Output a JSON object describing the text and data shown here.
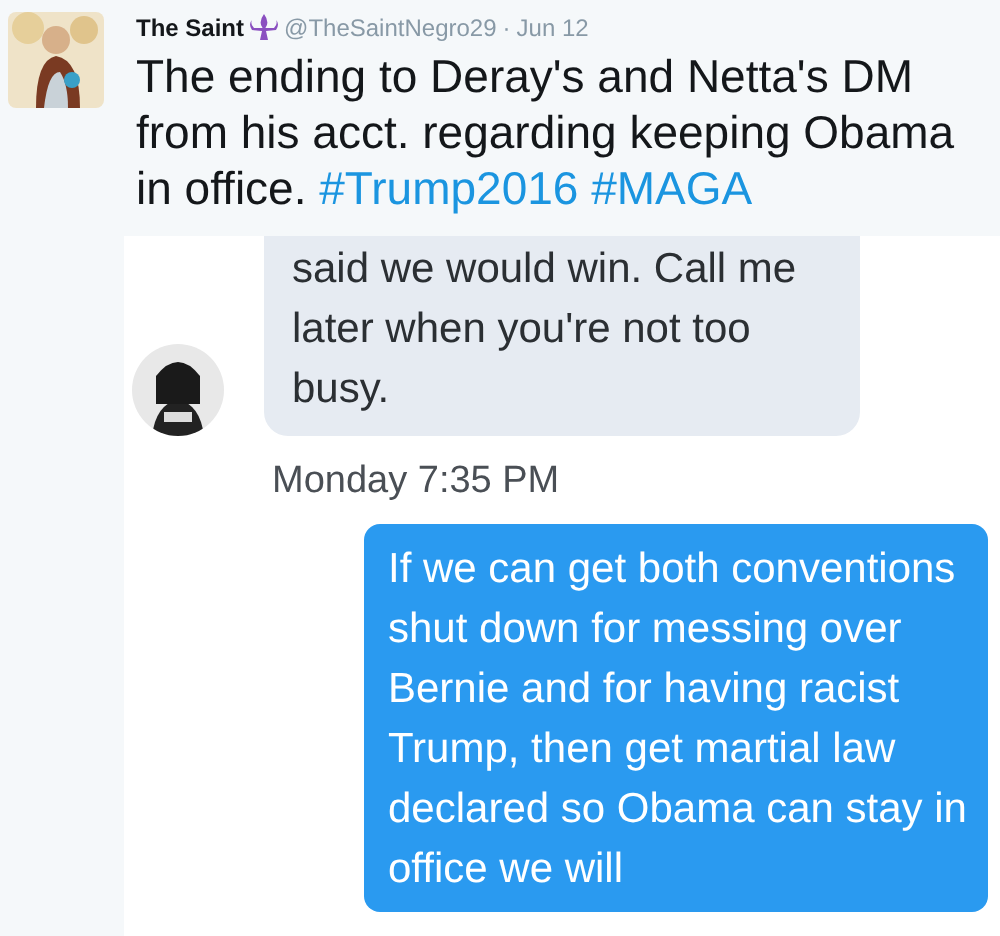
{
  "tweet": {
    "author": "The Saint",
    "handle": "@TheSaintNegro29",
    "separator": "·",
    "date": "Jun 12",
    "text": "The ending to Deray's and Netta's DM from his acct. regarding keeping Obama in office.",
    "hashtags": [
      "#Trump2016",
      "#MAGA"
    ]
  },
  "screenshot": {
    "messages": [
      {
        "kind": "received",
        "text": "said we would win. Call me later when you're not too busy."
      },
      {
        "kind": "timestamp",
        "text": "Monday 7:35 PM"
      },
      {
        "kind": "sent",
        "text": "If we can get both conventions shut down for messing over Bernie and for having racist Trump, then get martial law declared so Obama can stay in office we will"
      }
    ]
  }
}
